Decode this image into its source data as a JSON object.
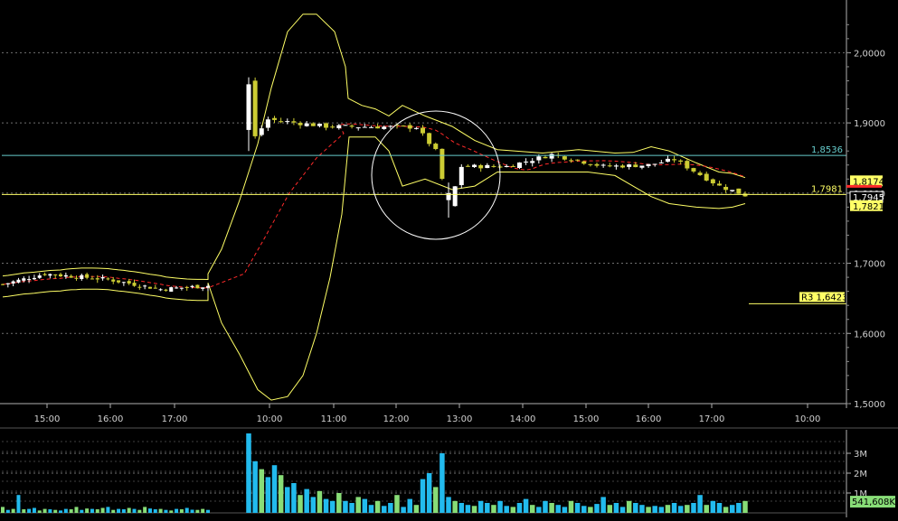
{
  "colors": {
    "background": "#000000",
    "grid": "#707070",
    "axis": "#b0b0b0",
    "axis_text": "#d0d0d0",
    "bollinger": "#ffff66",
    "ma": "#ff2a2a",
    "candle_up": "#ffffff",
    "candle_down": "#cccc33",
    "level_cyan": "#66cccc",
    "level_yellow": "#ffff66",
    "volume_blue": "#22bbee",
    "volume_green": "#88dd77",
    "circle": "#ffffff"
  },
  "chart_data": [
    {
      "type": "candlestick",
      "ylim": [
        1.5,
        2.07
      ],
      "yticks": [
        {
          "value": 1.5,
          "label": "1,5000"
        },
        {
          "value": 1.6,
          "label": "1,6000"
        },
        {
          "value": 1.7,
          "label": "1,7000"
        },
        {
          "value": 1.8,
          "label": "1,8000"
        },
        {
          "value": 1.9,
          "label": "1,9000"
        },
        {
          "value": 2.0,
          "label": "2,0000"
        }
      ],
      "xticks": [
        "15:00",
        "16:00",
        "17:00",
        "10:00",
        "11:00",
        "12:00",
        "13:00",
        "14:00",
        "15:00",
        "16:00",
        "17:00",
        "10:00"
      ],
      "levels": [
        {
          "label": "1,8536",
          "value": 1.8536,
          "color": "cyan"
        },
        {
          "label": "1,7981",
          "value": 1.7981,
          "color": "yellow"
        }
      ],
      "pivot": {
        "label": "R3 1,6423",
        "value": 1.6423
      },
      "price_tags": [
        {
          "label": "1,8174",
          "value": 1.8174,
          "style": "yellow"
        },
        {
          "label": "1,7945",
          "value": 1.7945,
          "style": "white"
        },
        {
          "label": "1,7821",
          "value": 1.7821,
          "style": "yellow"
        }
      ],
      "segments": [
        {
          "n": 40,
          "points": [
            [
              0,
              1.67
            ],
            [
              8,
              1.685
            ],
            [
              20,
              1.677
            ],
            [
              30,
              1.663
            ],
            [
              39,
              1.668
            ]
          ]
        },
        {
          "n": 78,
          "points": [
            [
              0,
              1.96
            ],
            [
              1,
              1.88
            ],
            [
              3,
              1.905
            ],
            [
              12,
              1.895
            ],
            [
              26,
              1.894
            ],
            [
              29,
              1.86
            ],
            [
              31,
              1.78
            ],
            [
              33,
              1.838
            ],
            [
              40,
              1.838
            ],
            [
              47,
              1.855
            ],
            [
              55,
              1.838
            ],
            [
              62,
              1.84
            ],
            [
              66,
              1.848
            ],
            [
              73,
              1.81
            ],
            [
              77,
              1.797
            ],
            [
              78,
              1.794
            ]
          ]
        }
      ]
    },
    {
      "type": "bar",
      "ylim": [
        0,
        4000
      ],
      "yticks": [
        {
          "value": 1000,
          "label": "1M"
        },
        {
          "value": 2000,
          "label": "2M"
        },
        {
          "value": 3000,
          "label": "3M"
        }
      ],
      "last_value_label": "541,608K",
      "values": [
        300,
        150,
        200,
        900,
        180,
        200,
        250,
        120,
        200,
        180,
        150,
        120,
        200,
        180,
        300,
        150,
        220,
        200,
        180,
        250,
        300,
        150,
        200,
        180,
        250,
        200,
        150,
        300,
        220,
        180,
        200,
        150,
        120,
        200,
        180,
        250,
        160,
        150,
        200,
        150,
        4000,
        2600,
        2200,
        1800,
        2400,
        1900,
        1300,
        1500,
        900,
        1200,
        800,
        1100,
        700,
        600,
        1000,
        600,
        500,
        800,
        700,
        400,
        600,
        350,
        500,
        900,
        300,
        700,
        400,
        1700,
        2000,
        1300,
        3000,
        800,
        600,
        500,
        400,
        350,
        600,
        500,
        400,
        600,
        350,
        300,
        500,
        700,
        400,
        300,
        600,
        500,
        400,
        300,
        600,
        500,
        350,
        300,
        450,
        800,
        400,
        500,
        300,
        600,
        500,
        400,
        300,
        350,
        300,
        400,
        500,
        350,
        400,
        500,
        900,
        400,
        600,
        500,
        300,
        400,
        500,
        600,
        300,
        400,
        500,
        450,
        500,
        540
      ],
      "colors_key": [
        0,
        1,
        0,
        1,
        0,
        1,
        1,
        0,
        0,
        1,
        0,
        1,
        1,
        0,
        0,
        1,
        0,
        1,
        0,
        0,
        1,
        0,
        1,
        1,
        0,
        1,
        0,
        0,
        1,
        1,
        0,
        1,
        0,
        1,
        0,
        1,
        1,
        0,
        0,
        1
      ]
    }
  ]
}
